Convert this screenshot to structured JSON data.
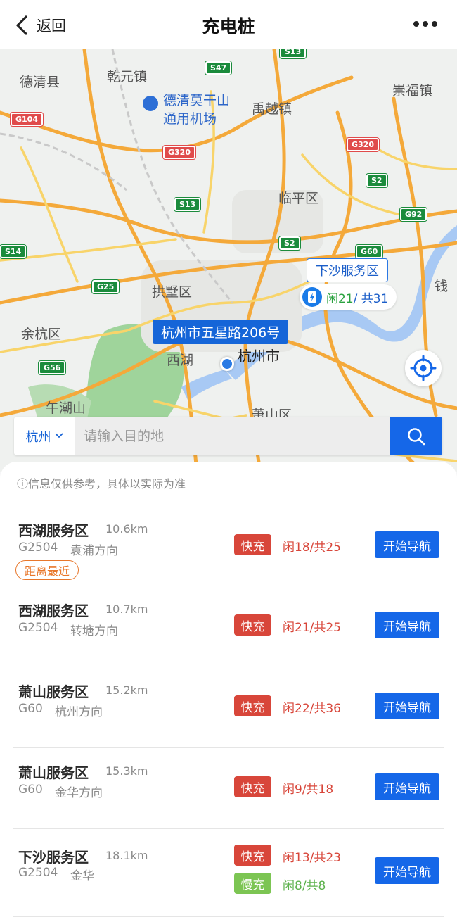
{
  "header": {
    "back_label": "返回",
    "title": "充电桩"
  },
  "map": {
    "places": [
      "德清县",
      "乾元镇",
      "德清莫干山",
      "通用机场",
      "禹越镇",
      "崇福镇",
      "临平区",
      "拱墅区",
      "余杭区",
      "西湖",
      "午潮山",
      "萧山区",
      "钱"
    ],
    "shields": [
      "S13",
      "S47",
      "G104",
      "G320",
      "G320",
      "S2",
      "S13",
      "G92",
      "S2",
      "G60",
      "S14",
      "G25",
      "G56"
    ],
    "location_bubble": "杭州市五星路206号",
    "city_label": "杭州市",
    "station_label": "下沙服务区",
    "station_free": "闲21",
    "station_total": "/ 共31"
  },
  "search": {
    "city": "杭州",
    "placeholder": "请输入目的地"
  },
  "notice": "ⓘ信息仅供参考，具体以实际为准",
  "stations": [
    {
      "name": "西湖服务区",
      "distance": "10.6km",
      "road": "G2504",
      "direction": "袁浦方向",
      "badge": "距离最近",
      "chargers": [
        {
          "type": "快充",
          "kind": "fast",
          "count": "闲18/共25"
        }
      ],
      "nav_label": "开始导航"
    },
    {
      "name": "西湖服务区",
      "distance": "10.7km",
      "road": "G2504",
      "direction": "转塘方向",
      "chargers": [
        {
          "type": "快充",
          "kind": "fast",
          "count": "闲21/共25"
        }
      ],
      "nav_label": "开始导航"
    },
    {
      "name": "萧山服务区",
      "distance": "15.2km",
      "road": "G60",
      "direction": "杭州方向",
      "chargers": [
        {
          "type": "快充",
          "kind": "fast",
          "count": "闲22/共36"
        }
      ],
      "nav_label": "开始导航"
    },
    {
      "name": "萧山服务区",
      "distance": "15.3km",
      "road": "G60",
      "direction": "金华方向",
      "chargers": [
        {
          "type": "快充",
          "kind": "fast",
          "count": "闲9/共18"
        }
      ],
      "nav_label": "开始导航"
    },
    {
      "name": "下沙服务区",
      "distance": "18.1km",
      "road": "G2504",
      "direction": "金华",
      "chargers": [
        {
          "type": "快充",
          "kind": "fast",
          "count": "闲13/共23"
        },
        {
          "type": "慢充",
          "kind": "slow",
          "count": "闲8/共8"
        }
      ],
      "nav_label": "开始导航"
    }
  ]
}
